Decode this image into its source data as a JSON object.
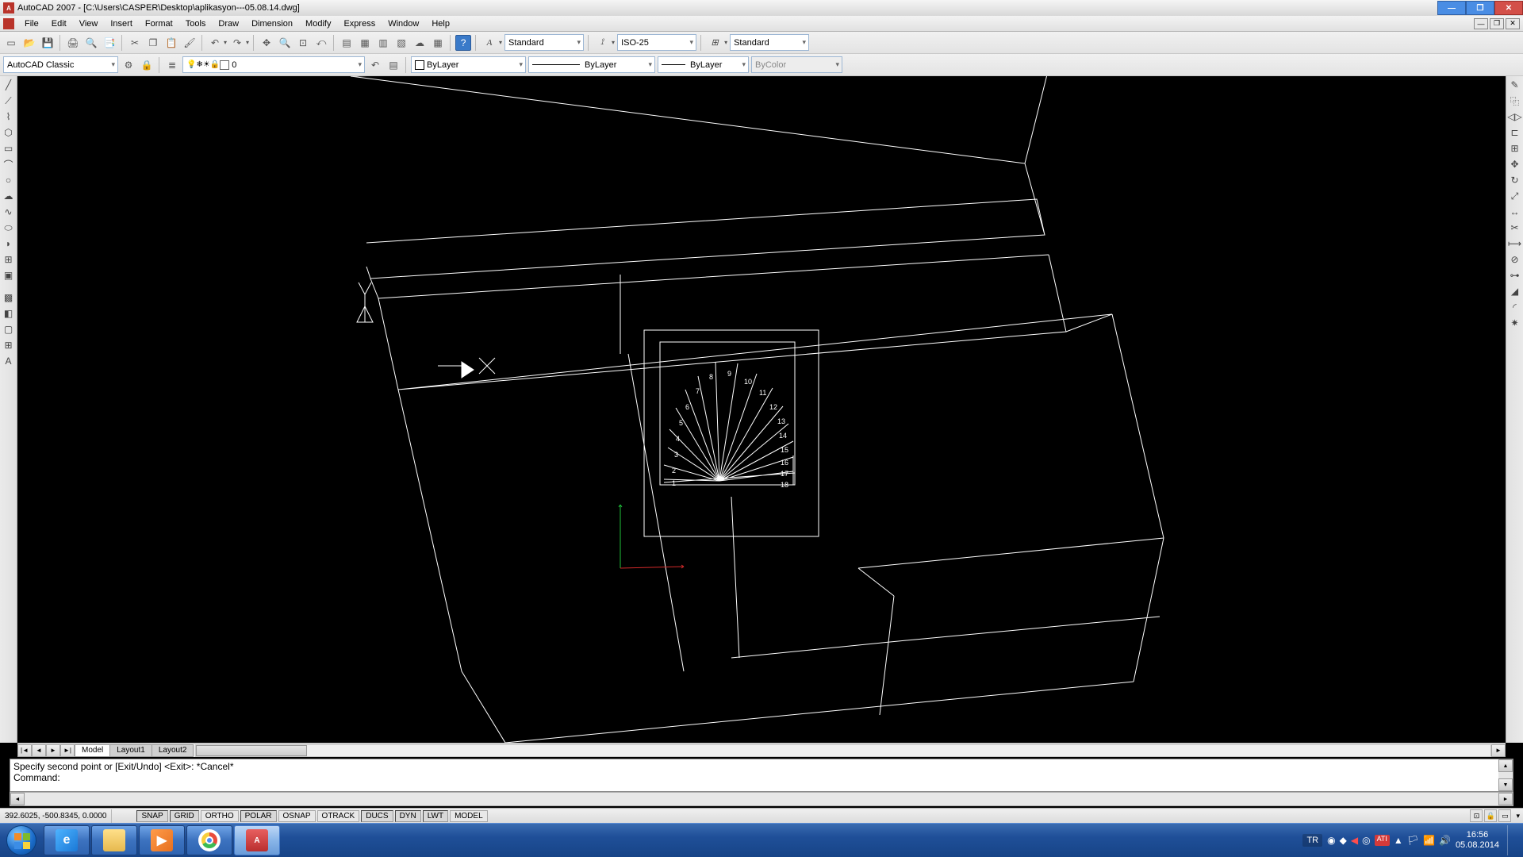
{
  "title": "AutoCAD 2007 - [C:\\Users\\CASPER\\Desktop\\aplikasyon---05.08.14.dwg]",
  "menus": [
    "File",
    "Edit",
    "View",
    "Insert",
    "Format",
    "Tools",
    "Draw",
    "Dimension",
    "Modify",
    "Express",
    "Window",
    "Help"
  ],
  "styles": {
    "text": "Standard",
    "dim": "ISO-25",
    "table": "Standard"
  },
  "workspace": "AutoCAD Classic",
  "layer": {
    "name": "0"
  },
  "props": {
    "color": "ByLayer",
    "linetype": "ByLayer",
    "lineweight": "ByLayer",
    "plotstyle": "ByColor"
  },
  "tabs": {
    "model": "Model",
    "layout1": "Layout1",
    "layout2": "Layout2"
  },
  "cmd": {
    "line1": "Specify second point or [Exit/Undo] <Exit>: *Cancel*",
    "prompt": "Command:"
  },
  "status": {
    "coords": "392.6025, -500.8345, 0.0000",
    "toggles": [
      "SNAP",
      "GRID",
      "ORTHO",
      "POLAR",
      "OSNAP",
      "OTRACK",
      "DUCS",
      "DYN",
      "LWT",
      "MODEL"
    ]
  },
  "tray": {
    "lang": "TR",
    "time": "16:56",
    "date": "05.08.2014"
  },
  "stair_numbers": [
    "1",
    "2",
    "3",
    "4",
    "5",
    "6",
    "7",
    "8",
    "9",
    "10",
    "11",
    "12",
    "13",
    "14",
    "15",
    "16",
    "17",
    "18"
  ]
}
